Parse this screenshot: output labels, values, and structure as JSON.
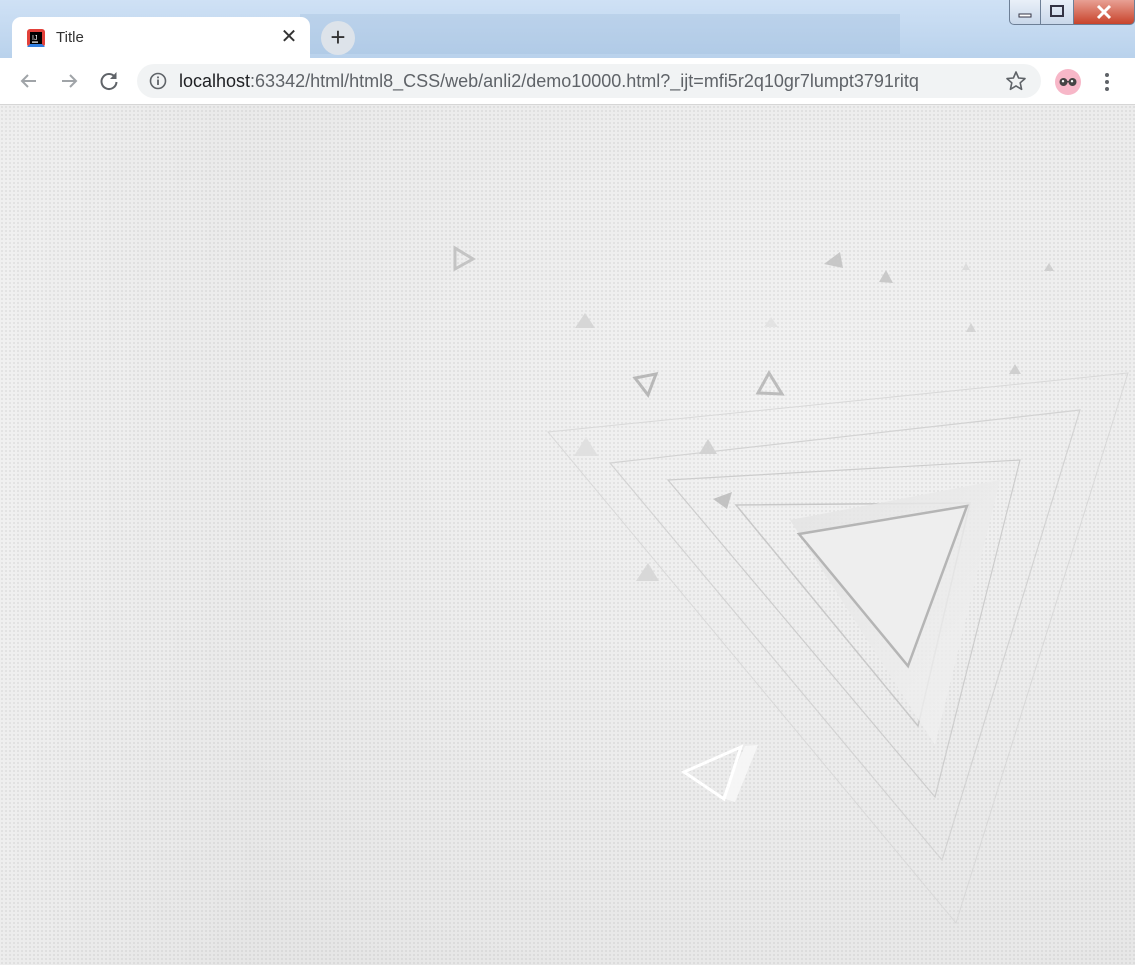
{
  "browser": {
    "tab": {
      "title": "Title",
      "close_glyph": "✕",
      "favicon": "intellij-icon"
    },
    "new_tab_glyph": "+",
    "window_controls": [
      "minimize-icon",
      "maximize-icon",
      "close-icon"
    ],
    "toolbar": {
      "back_icon": "arrow-left-icon",
      "forward_icon": "arrow-right-icon",
      "reload_icon": "reload-icon",
      "url_host": "localhost",
      "url_rest": ":63342/html/html8_CSS/web/anli2/demo10000.html?_ijt=mfi5r2q10gr7lumpt3791ritq",
      "bookmark_icon": "star-icon",
      "profile_icon": "avatar-glasses-icon",
      "menu_icon": "kebab-menu-icon"
    }
  },
  "page": {
    "background": "light-gray-dotted-texture",
    "decoration": "nested-triangles-outline"
  }
}
